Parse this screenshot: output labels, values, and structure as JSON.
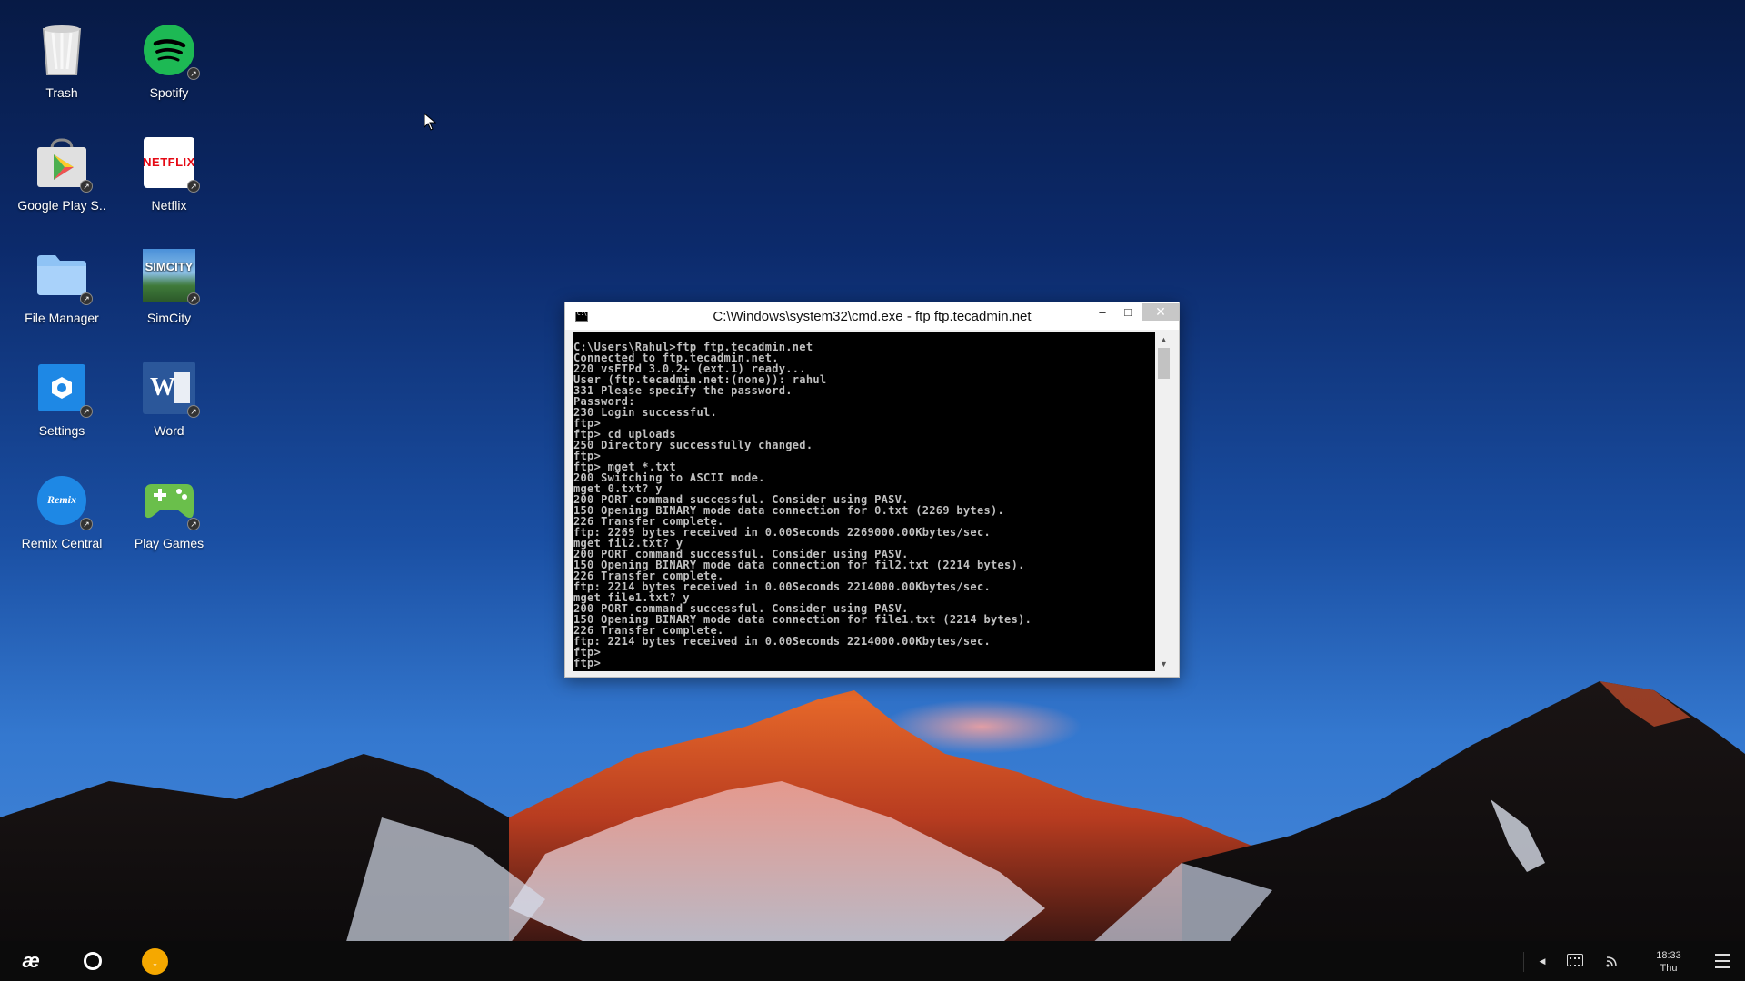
{
  "desktop": {
    "icons": [
      {
        "label": "Trash",
        "icon": "trash-icon"
      },
      {
        "label": "Spotify",
        "icon": "spotify-icon"
      },
      {
        "label": "Google Play S..",
        "icon": "google-play-icon"
      },
      {
        "label": "Netflix",
        "icon": "netflix-icon"
      },
      {
        "label": "File Manager",
        "icon": "folder-icon"
      },
      {
        "label": "SimCity",
        "icon": "simcity-icon"
      },
      {
        "label": "Settings",
        "icon": "settings-icon"
      },
      {
        "label": "Word",
        "icon": "word-icon"
      },
      {
        "label": "Remix Central",
        "icon": "remix-central-icon"
      },
      {
        "label": "Play Games",
        "icon": "gamepad-icon"
      }
    ],
    "netflix_logo_text": "NETFLIX",
    "simcity_logo_text": "SIMCITY",
    "word_logo_text": "W",
    "remix_logo_text": "Remix"
  },
  "cmd": {
    "title": "C:\\Windows\\system32\\cmd.exe - ftp  ftp.tecadmin.net",
    "minimize_glyph": "–",
    "maximize_glyph": "□",
    "close_glyph": "✕",
    "lines": [
      "C:\\Users\\Rahul>ftp ftp.tecadmin.net",
      "Connected to ftp.tecadmin.net.",
      "220 vsFTPd 3.0.2+ (ext.1) ready...",
      "User (ftp.tecadmin.net:(none)): rahul",
      "331 Please specify the password.",
      "Password:",
      "230 Login successful.",
      "ftp>",
      "ftp> cd uploads",
      "250 Directory successfully changed.",
      "ftp>",
      "ftp> mget *.txt",
      "200 Switching to ASCII mode.",
      "mget 0.txt? y",
      "200 PORT command successful. Consider using PASV.",
      "150 Opening BINARY mode data connection for 0.txt (2269 bytes).",
      "226 Transfer complete.",
      "ftp: 2269 bytes received in 0.00Seconds 2269000.00Kbytes/sec.",
      "mget fil2.txt? y",
      "200 PORT command successful. Consider using PASV.",
      "150 Opening BINARY mode data connection for fil2.txt (2214 bytes).",
      "226 Transfer complete.",
      "ftp: 2214 bytes received in 0.00Seconds 2214000.00Kbytes/sec.",
      "mget file1.txt? y",
      "200 PORT command successful. Consider using PASV.",
      "150 Opening BINARY mode data connection for file1.txt (2214 bytes).",
      "226 Transfer complete.",
      "ftp: 2214 bytes received in 0.00Seconds 2214000.00Kbytes/sec.",
      "ftp>",
      "ftp>"
    ]
  },
  "taskbar": {
    "start_glyph": "æ",
    "clock_time": "18:33",
    "clock_day": "Thu"
  },
  "colors": {
    "spotify": "#1db954",
    "netflix_red": "#e50914",
    "settings_blue": "#1e88e5",
    "word_blue": "#2b579a",
    "download_orange": "#f5a800"
  }
}
